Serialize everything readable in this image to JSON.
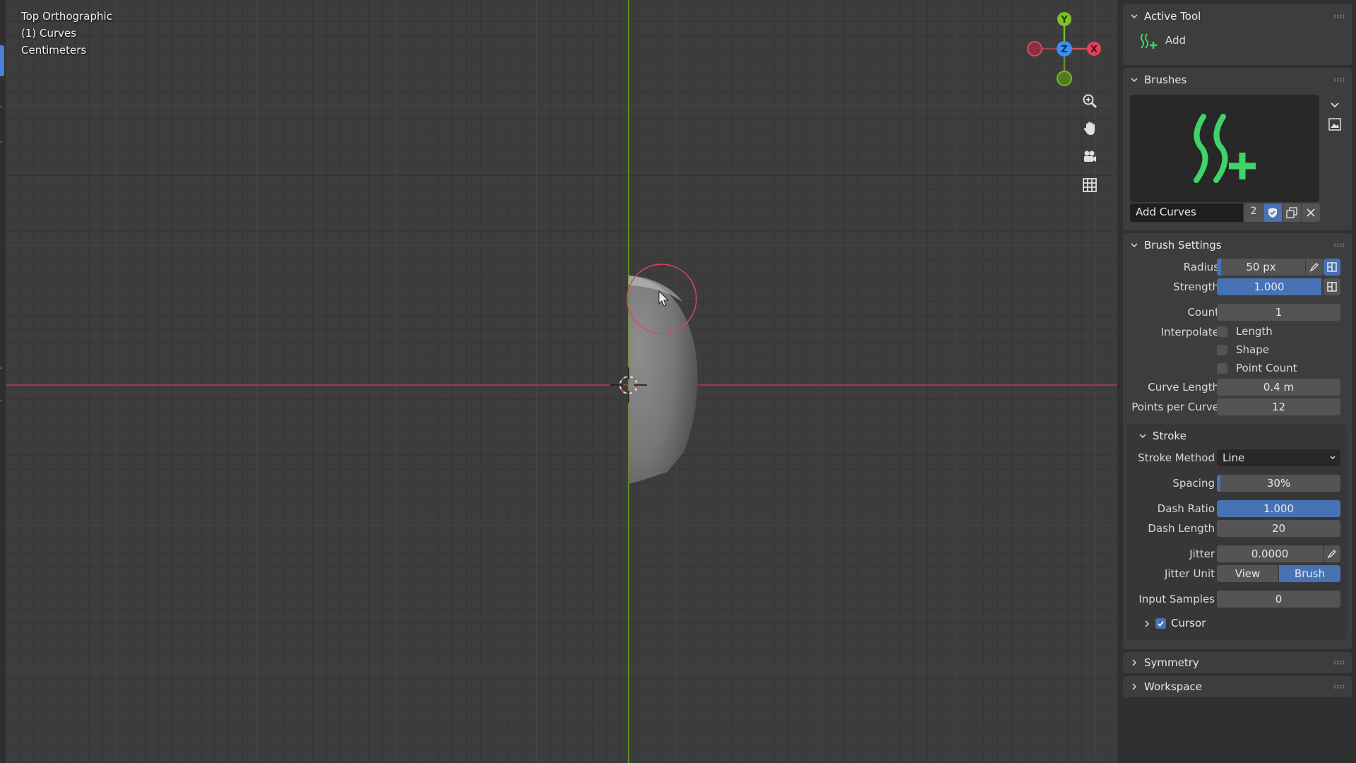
{
  "viewport": {
    "view_name": "Top Orthographic",
    "object_label": "(1) Curves",
    "units": "Centimeters",
    "gizmo": {
      "y_label": "Y",
      "z_label": "Z",
      "x_label": "X"
    }
  },
  "sidebar": {
    "active_tool": {
      "title": "Active Tool",
      "tool_name": "Add"
    },
    "brushes": {
      "title": "Brushes",
      "brush_name": "Add Curves",
      "user_count": "2"
    },
    "brush_settings": {
      "title": "Brush Settings",
      "radius_label": "Radius",
      "radius_value": "50 px",
      "radius_fill": 0.05,
      "strength_label": "Strength",
      "strength_value": "1.000",
      "count_label": "Count",
      "count_value": "1",
      "interpolate_label": "Interpolate",
      "interp_length": "Length",
      "interp_shape": "Shape",
      "interp_point_count": "Point Count",
      "curve_length_label": "Curve Length",
      "curve_length_value": "0.4 m",
      "points_per_curve_label": "Points per Curve",
      "points_per_curve_value": "12"
    },
    "stroke": {
      "title": "Stroke",
      "method_label": "Stroke Method",
      "method_value": "Line",
      "spacing_label": "Spacing",
      "spacing_value": "30%",
      "spacing_fill": 0.03,
      "dash_ratio_label": "Dash Ratio",
      "dash_ratio_value": "1.000",
      "dash_length_label": "Dash Length",
      "dash_length_value": "20",
      "jitter_label": "Jitter",
      "jitter_value": "0.0000",
      "jitter_unit_label": "Jitter Unit",
      "jitter_unit_view": "View",
      "jitter_unit_brush": "Brush",
      "input_samples_label": "Input Samples",
      "input_samples_value": "0",
      "cursor_label": "Cursor"
    },
    "symmetry": {
      "title": "Symmetry"
    },
    "workspace": {
      "title": "Workspace"
    }
  },
  "colors": {
    "accent": "#4772b3",
    "axis_x": "#9a3a48",
    "axis_y": "#5f8f20",
    "brush_icon": "#3ed46a"
  }
}
